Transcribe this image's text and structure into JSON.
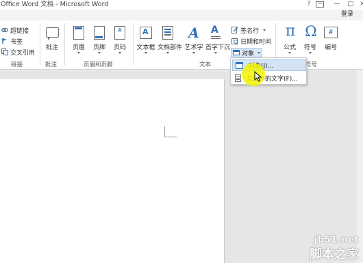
{
  "window": {
    "title": "Office Word 文档 - Microsoft Word",
    "help": "?",
    "minimize": "—",
    "maximize": "□",
    "close": "×",
    "sign_in": "登录"
  },
  "ribbon": {
    "groups": {
      "links": {
        "label": "链接",
        "items": [
          {
            "label": "超链接",
            "icon": "hyperlink-icon"
          },
          {
            "label": "书签",
            "icon": "bookmark-icon"
          },
          {
            "label": "交叉引用",
            "icon": "cross-reference-icon"
          }
        ]
      },
      "comments": {
        "label": "批注",
        "items": [
          {
            "label": "批注",
            "icon": "comment-icon"
          }
        ]
      },
      "header_footer": {
        "label": "页眉和页脚",
        "items": [
          {
            "label": "页眉",
            "icon": "header-icon"
          },
          {
            "label": "页脚",
            "icon": "footer-icon"
          },
          {
            "label": "页码",
            "icon": "page-number-icon",
            "glyph": "#"
          }
        ]
      },
      "text": {
        "label": "文本",
        "items": [
          {
            "label": "文本框",
            "icon": "textbox-icon"
          },
          {
            "label": "文档部件",
            "icon": "document-parts-icon"
          },
          {
            "label": "艺术字",
            "icon": "wordart-icon",
            "glyph": "A"
          },
          {
            "label": "首字下沉",
            "icon": "drop-cap-icon"
          }
        ],
        "small_items": [
          {
            "label": "签名行",
            "icon": "signature-line-icon"
          },
          {
            "label": "日期和时间",
            "icon": "date-time-icon"
          },
          {
            "label": "对象",
            "icon": "object-icon"
          }
        ]
      },
      "symbols": {
        "label": "符号",
        "items": [
          {
            "label": "公式",
            "icon": "equation-icon",
            "glyph": "π"
          },
          {
            "label": "符号",
            "icon": "symbol-icon",
            "glyph": "Ω"
          },
          {
            "label": "编号",
            "icon": "numbering-icon",
            "glyph": "#"
          }
        ]
      }
    }
  },
  "object_menu": {
    "items": [
      {
        "label": "对象(J)...",
        "icon": "object-icon"
      },
      {
        "label": "文件中的文字(F)...",
        "icon": "text-from-file-icon"
      }
    ]
  },
  "watermark": {
    "domain": "jb51.net",
    "name": "脚本之家"
  },
  "colors": {
    "accent": "#2f6fb6",
    "highlight": "#f5f500",
    "menu_hover": "#d3e3f5"
  }
}
